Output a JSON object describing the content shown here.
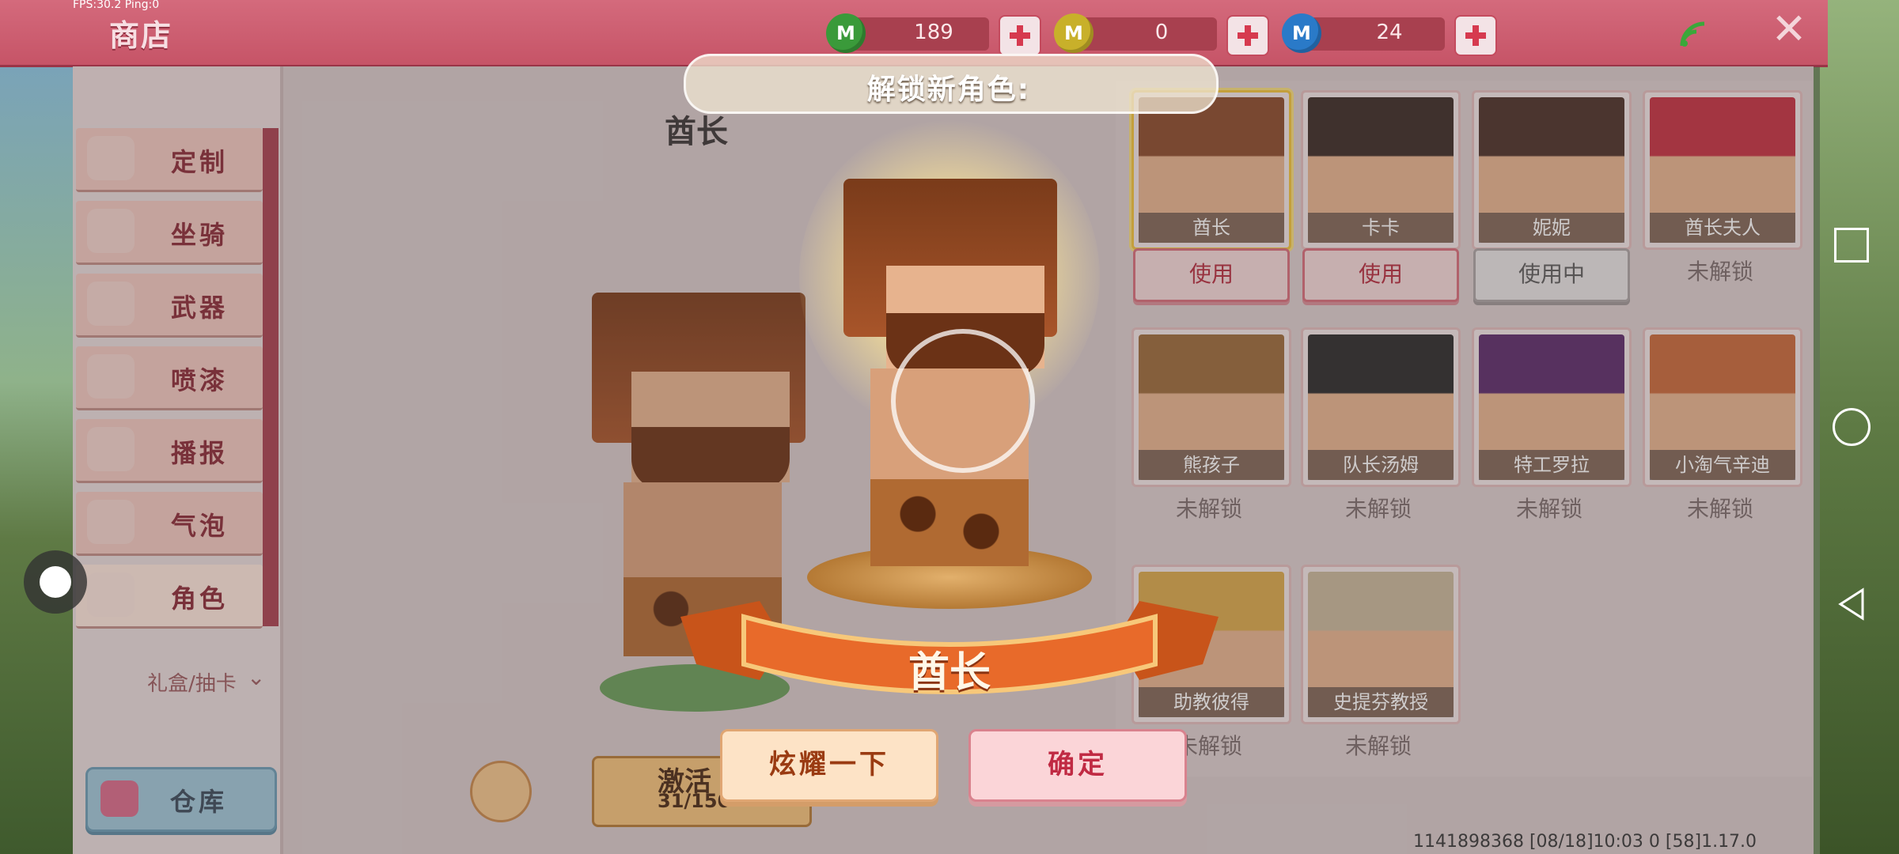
{
  "hud": {
    "fps": "FPS:30.2  Ping:0",
    "title": "商店",
    "currencies": [
      {
        "icon": "green-m-coin-icon",
        "value": "189"
      },
      {
        "icon": "yellow-m-coin-icon",
        "value": "0"
      },
      {
        "icon": "blue-m-coin-icon",
        "value": "24"
      }
    ]
  },
  "sidebar": {
    "items": [
      {
        "label": "定制"
      },
      {
        "label": "坐骑"
      },
      {
        "label": "武器"
      },
      {
        "label": "喷漆"
      },
      {
        "label": "播报"
      },
      {
        "label": "气泡"
      },
      {
        "label": "角色",
        "active": true
      }
    ],
    "gift_label": "礼盒/抽卡",
    "warehouse_label": "仓库"
  },
  "preview": {
    "character_name": "酋长",
    "activate_label": "激活",
    "activate_count": "31/150"
  },
  "popup": {
    "banner_text": "解锁新角色:",
    "ribbon_text": "酋长",
    "show_off_label": "炫耀一下",
    "confirm_label": "确定"
  },
  "roster": {
    "cards": [
      {
        "name": "酋长",
        "action": "使用",
        "state": "use",
        "selected": true,
        "color": "#8a4a2a"
      },
      {
        "name": "卡卡",
        "action": "使用",
        "state": "use",
        "color": "#3a2a24"
      },
      {
        "name": "妮妮",
        "action": "使用中",
        "state": "inuse",
        "color": "#4a3028"
      },
      {
        "name": "酋长夫人",
        "action": "未解锁",
        "state": "locked",
        "color": "#c43040"
      },
      {
        "name": "熊孩子",
        "action": "未解锁",
        "state": "locked",
        "color": "#9a6a3a"
      },
      {
        "name": "队长汤姆",
        "action": "未解锁",
        "state": "locked",
        "color": "#2a2a2a"
      },
      {
        "name": "特工罗拉",
        "action": "未解锁",
        "state": "locked",
        "color": "#5a2a6a"
      },
      {
        "name": "小淘气辛迪",
        "action": "未解锁",
        "state": "locked",
        "color": "#c8683a"
      },
      {
        "name": "助教彼得",
        "action": "未解锁",
        "state": "locked",
        "color": "#d8a84a"
      },
      {
        "name": "史提芬教授",
        "action": "未解锁",
        "state": "locked",
        "color": "#c8b89a"
      }
    ]
  },
  "status_line": "1141898368    [08/18]10:03 0    [58]1.17.0"
}
